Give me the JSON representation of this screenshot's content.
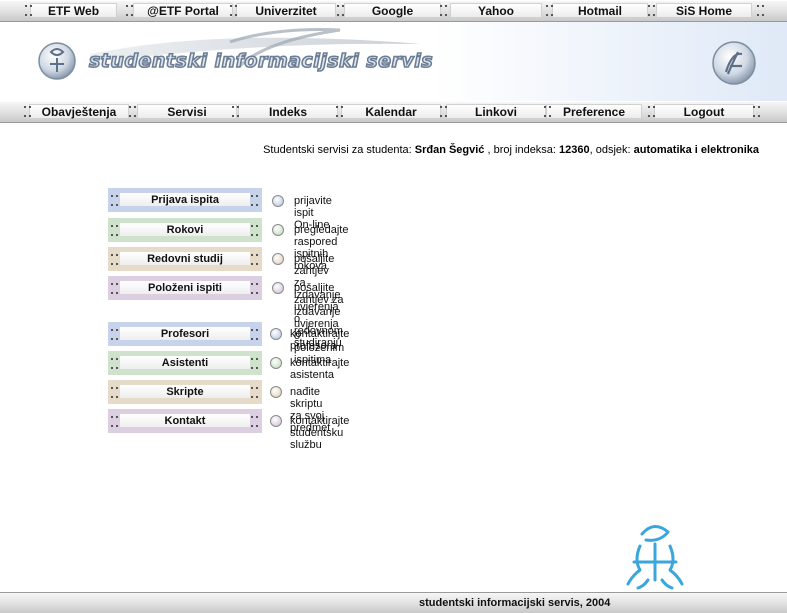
{
  "top_nav": [
    "ETF Web",
    "@ETF Portal",
    "Univerzitet",
    "Google",
    "Yahoo",
    "Hotmail",
    "SiS Home"
  ],
  "header": {
    "logo_text": "studentski informacijski servis"
  },
  "main_nav": [
    "Obavještenja",
    "Servisi",
    "Indeks",
    "Kalendar",
    "Linkovi",
    "Preference",
    "Logout"
  ],
  "student_info": {
    "prefix": "Studentski servisi za studenta:",
    "name": "Srđan Šegvić",
    "index_label": ", broj indeksa:",
    "index": "12360",
    "dept_label": ", odsjek:",
    "dept": "automatika i elektronika"
  },
  "menu_group1": [
    {
      "label": "Prijava ispita",
      "desc": "prijavite ispit On-line",
      "color": "#c7d3ea"
    },
    {
      "label": "Rokovi",
      "desc": "pregledajte raspored ispitnih rokova",
      "color": "#cfe3cc"
    },
    {
      "label": "Redovni studij",
      "desc": "pošaljite zahtjev za izdavanje uvjerenja o redovnom studiranju",
      "color": "#e6dac8"
    },
    {
      "label": "Položeni ispiti",
      "desc": "pošaljite zahtjev za izdavanje uvjerenja o položenim ispitima",
      "color": "#dccfe2"
    }
  ],
  "menu_group2": [
    {
      "label": "Profesori",
      "desc": "kontaktirajte profesora",
      "color": "#c7d3ea"
    },
    {
      "label": "Asistenti",
      "desc": "kontaktirajte asistenta",
      "color": "#cfe3cc"
    },
    {
      "label": "Skripte",
      "desc": "nađite skriptu za svoj predmet",
      "color": "#e6dac8"
    },
    {
      "label": "Kontakt",
      "desc": "kontaktirajte studentsku službu",
      "color": "#dccfe2"
    }
  ],
  "footer": {
    "text": "studentski informacijski servis, 2004"
  }
}
